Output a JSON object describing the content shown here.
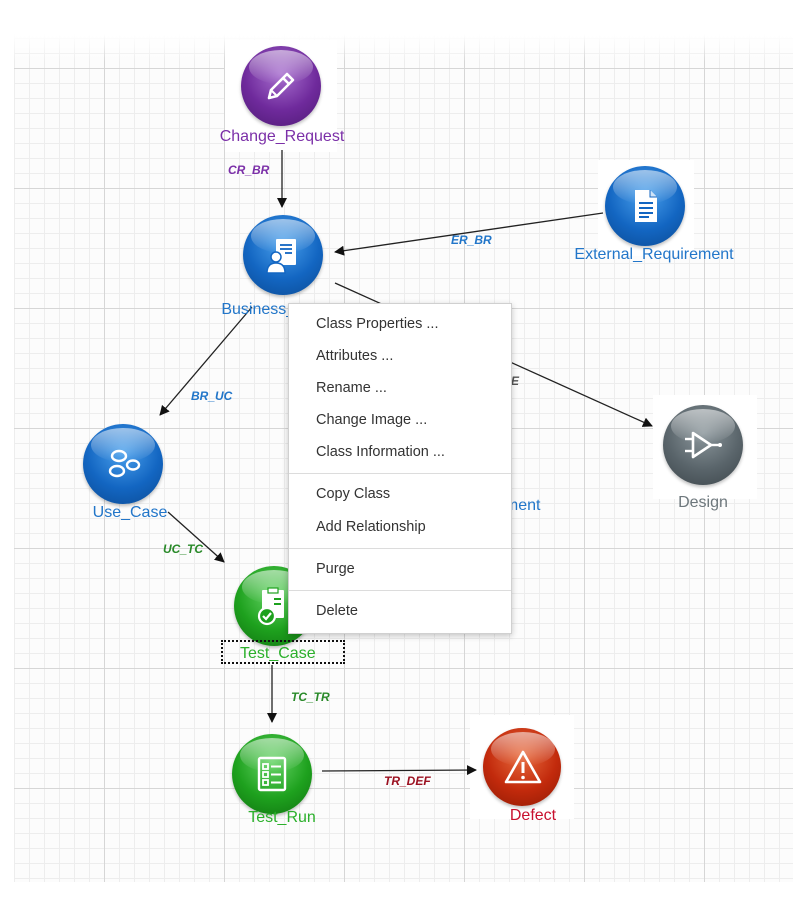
{
  "nodes": {
    "change_request": {
      "label": "Change_Request",
      "color": "#7b2fa8",
      "icon": "pencil-icon"
    },
    "business_requirement": {
      "label": "Business_R",
      "color": "#2276c9",
      "icon": "business-document-icon"
    },
    "external_requirement": {
      "label": "External_Requirement",
      "color": "#2276c9",
      "icon": "document-icon"
    },
    "use_case": {
      "label": "Use_Case",
      "color": "#2276c9",
      "icon": "use-case-icon"
    },
    "hidden_requirement": {
      "label": "ement",
      "color": "#2276c9"
    },
    "design": {
      "label": "Design",
      "color": "#5f6a70",
      "icon": "design-flow-icon"
    },
    "test_case": {
      "label": "Test_Case",
      "color": "#2bb02b",
      "icon": "checklist-icon"
    },
    "test_run": {
      "label": "Test_Run",
      "color": "#2bb02b",
      "icon": "test-run-list-icon"
    },
    "defect": {
      "label": "Defect",
      "color": "#c8102e",
      "icon": "warning-icon"
    }
  },
  "edges": {
    "cr_br": {
      "label": "CR_BR",
      "color": "#7b2fa8"
    },
    "er_br": {
      "label": "ER_BR",
      "color": "#2276c9"
    },
    "br_uc": {
      "label": "BR_UC",
      "color": "#2276c9"
    },
    "br_design": {
      "label": "E",
      "color": "#555555"
    },
    "uc_tc": {
      "label": "UC_TC",
      "color": "#2a8a2a"
    },
    "tc_tr": {
      "label": "TC_TR",
      "color": "#2a8a2a"
    },
    "tr_def": {
      "label": "TR_DEF",
      "color": "#9b1020"
    }
  },
  "context_menu": {
    "class_properties": "Class Properties ...",
    "attributes": "Attributes ...",
    "rename": "Rename ...",
    "change_image": "Change Image ...",
    "class_information": "Class Information ...",
    "copy_class": "Copy Class",
    "add_relationship": "Add Relationship",
    "purge": "Purge",
    "delete": "Delete"
  }
}
